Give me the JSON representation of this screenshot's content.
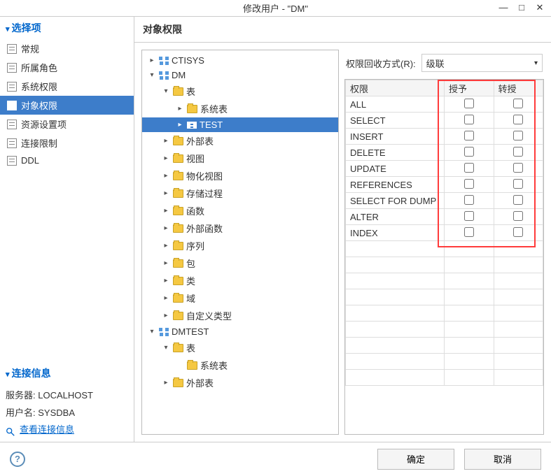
{
  "window": {
    "title": "修改用户 - \"DM\""
  },
  "sidebar": {
    "options_title": "选择项",
    "items": [
      {
        "label": "常规"
      },
      {
        "label": "所属角色"
      },
      {
        "label": "系统权限"
      },
      {
        "label": "对象权限",
        "selected": true
      },
      {
        "label": "资源设置项"
      },
      {
        "label": "连接限制"
      },
      {
        "label": "DDL"
      }
    ],
    "conn_title": "连接信息",
    "server_label": "服务器:",
    "server_value": "LOCALHOST",
    "user_label": "用户名:",
    "user_value": "SYSDBA",
    "view_conn": "查看连接信息"
  },
  "content": {
    "header": "对象权限",
    "recall_label": "权限回收方式(R):",
    "recall_value": "级联",
    "perm_columns": {
      "name": "权限",
      "granted": "授予",
      "transfer": "转授"
    },
    "permissions": [
      "ALL",
      "SELECT",
      "INSERT",
      "DELETE",
      "UPDATE",
      "REFERENCES",
      "SELECT FOR DUMP",
      "ALTER",
      "INDEX"
    ]
  },
  "tree": {
    "ctisys": "CTISYS",
    "dm": "DM",
    "table": "表",
    "sys_table": "系统表",
    "test": "TEST",
    "ext_table": "外部表",
    "view": "视图",
    "mat_view": "物化视图",
    "sp": "存储过程",
    "func": "函数",
    "ext_func": "外部函数",
    "seq": "序列",
    "pkg": "包",
    "class": "类",
    "domain": "域",
    "udt": "自定义类型",
    "dmtest": "DMTEST",
    "dmtest_table": "表",
    "dmtest_systable": "系统表",
    "dmtest_ext": "外部表"
  },
  "footer": {
    "ok": "确定",
    "cancel": "取消"
  }
}
